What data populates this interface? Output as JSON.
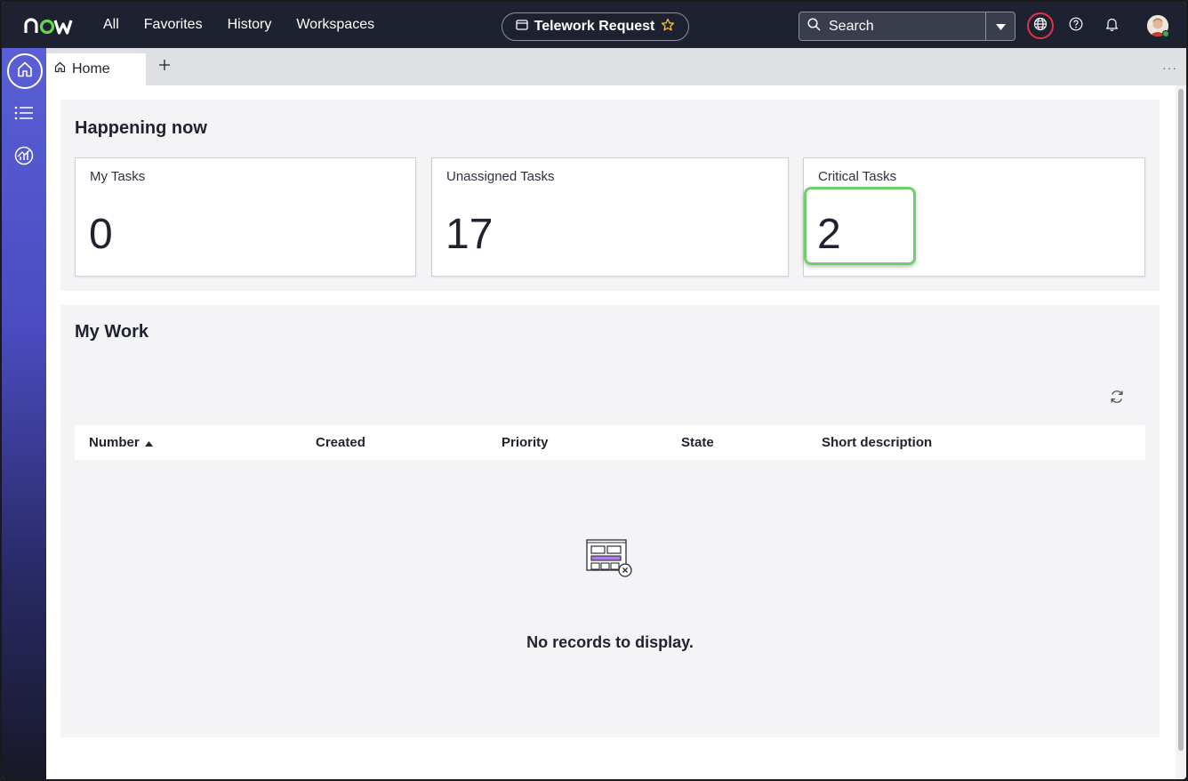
{
  "topbar": {
    "logo_text": "now",
    "nav": [
      "All",
      "Favorites",
      "History",
      "Workspaces"
    ],
    "context_title": "Telework Request",
    "search_placeholder": "Search"
  },
  "sidebar": {
    "items": [
      "home-icon",
      "list-icon",
      "analytics-icon"
    ]
  },
  "tabs": {
    "home_label": "Home",
    "more_label": "···"
  },
  "happening": {
    "title": "Happening now",
    "cards": [
      {
        "label": "My Tasks",
        "value": "0"
      },
      {
        "label": "Unassigned Tasks",
        "value": "17"
      },
      {
        "label": "Critical Tasks",
        "value": "2"
      }
    ]
  },
  "my_work": {
    "title": "My Work",
    "columns": [
      "Number",
      "Created",
      "Priority",
      "State",
      "Short description"
    ],
    "sort_column": "Number",
    "empty_text": "No records to display."
  },
  "colors": {
    "topbar": "#1e2130",
    "accent_ring": "#e03348",
    "highlight": "#6fcf6b",
    "sidebar_top": "#5a5fd6"
  }
}
